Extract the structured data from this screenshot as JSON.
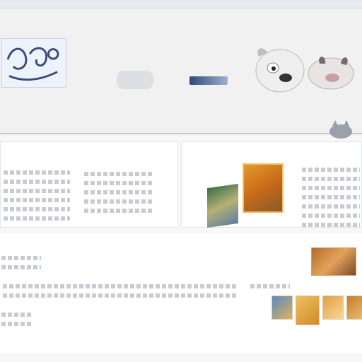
{
  "browser": {
    "title": ""
  },
  "masthead": {
    "marquee": "",
    "site_title": "",
    "tagline": ""
  },
  "panels": {
    "left": {
      "title": "",
      "subtitle": ""
    },
    "right": {
      "title": ""
    }
  },
  "sections": {
    "a": {
      "label": "",
      "body": ""
    },
    "b": {
      "label": ""
    }
  },
  "footer": {
    "link": ""
  },
  "colors": {
    "accent_blue": "#2f4a7a",
    "thumb_orange": "#e49a2b",
    "text_dark": "#3a4048",
    "text_muted": "#6a737e"
  },
  "icons": {
    "logo": "doodle-logo-icon",
    "mascot": "dog-mascot-icon",
    "corner": "cat-icon"
  }
}
